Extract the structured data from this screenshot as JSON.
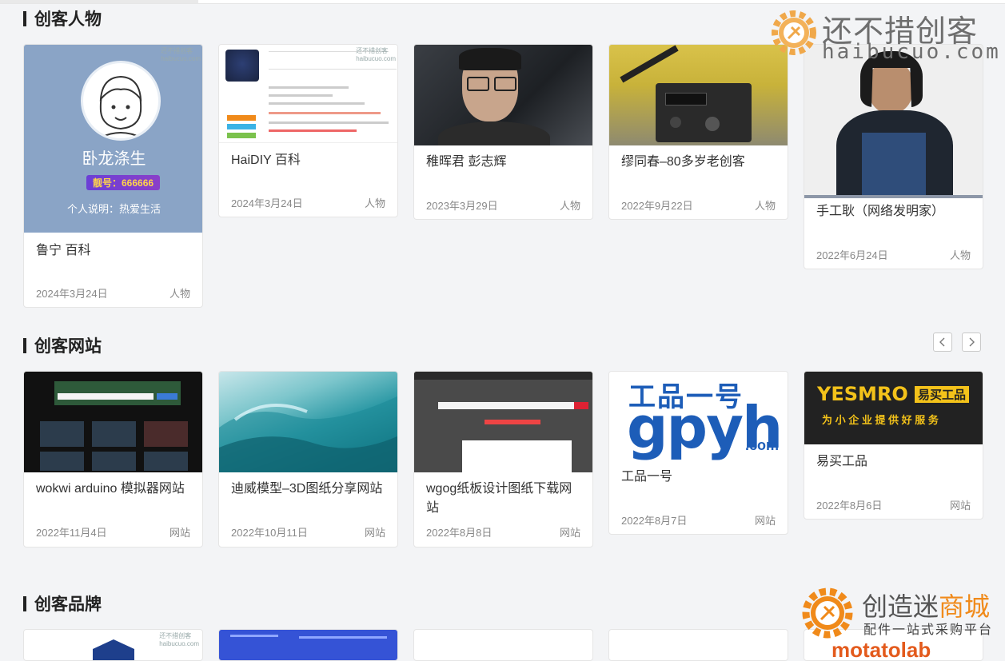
{
  "sections": [
    {
      "title": "创客人物"
    },
    {
      "title": "创客网站"
    },
    {
      "title": "创客品牌"
    }
  ],
  "people": [
    {
      "title": "鲁宁 百科",
      "date": "2024年3月24日",
      "cat": "人物",
      "profile_name": "卧龙涤生",
      "profile_id": "靓号：666666",
      "profile_desc": "个人说明：热爱生活"
    },
    {
      "title": "HaiDIY 百科",
      "date": "2024年3月24日",
      "cat": "人物"
    },
    {
      "title": "稚晖君 彭志辉",
      "date": "2023年3月29日",
      "cat": "人物"
    },
    {
      "title": "缪同春–80多岁老创客",
      "date": "2022年9月22日",
      "cat": "人物"
    },
    {
      "title": "手工耿（网络发明家）",
      "date": "2022年6月24日",
      "cat": "人物"
    }
  ],
  "sites": [
    {
      "title": "wokwi arduino 模拟器网站",
      "date": "2022年11月4日",
      "cat": "网站"
    },
    {
      "title": "迪威模型–3D图纸分享网站",
      "date": "2022年10月11日",
      "cat": "网站"
    },
    {
      "title": "wgog纸板设计图纸下载网站",
      "date": "2022年8月8日",
      "cat": "网站"
    },
    {
      "title": "工品一号",
      "date": "2022年8月7日",
      "cat": "网站",
      "logo_top": "工品一号",
      "logo_main": "gpyh",
      ".com": ".com"
    },
    {
      "title": "易买工品",
      "date": "2022年8月6日",
      "cat": "网站",
      "logo_main": "YESMRO",
      "logo_cn": "易买工品",
      "slogan": "为 小 企 业 提 供 好 服 务"
    }
  ],
  "thumb_watermark": "还不措创客",
  "thumb_watermark_url": "haibucuo.com",
  "watermark_top": {
    "line1": "还不措创客",
    "line2": "haibucuo.com"
  },
  "watermark_bottom": {
    "line1a": "创造迷",
    "line1b": "商城",
    "line2": "配件一站式采购平台"
  },
  "brand_partial": "motatolab",
  "colors": {
    "accent": "#f08a1a",
    "profile_bg": "#8aa4c6",
    "gpyh_blue": "#1d5db8"
  }
}
